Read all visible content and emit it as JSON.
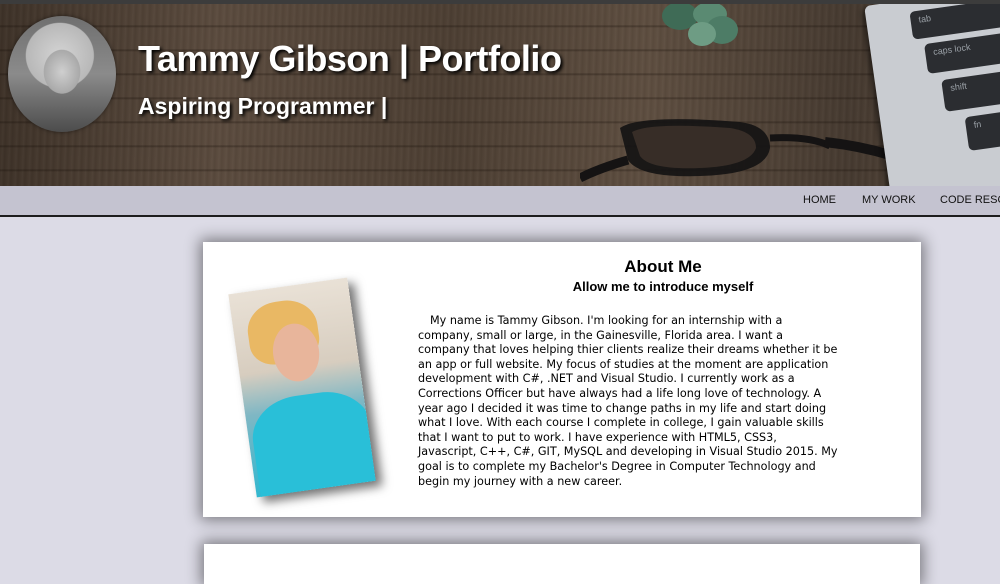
{
  "header": {
    "title": "Tammy Gibson | Portfolio",
    "subtitle": "Aspiring Programmer |"
  },
  "banner_keys": [
    "tab",
    "caps lock",
    "shift",
    "fn"
  ],
  "nav": {
    "items": [
      "HOME",
      "MY WORK",
      "CODE RESOU"
    ]
  },
  "about": {
    "title": "About Me",
    "subtitle": "Allow me to introduce myself",
    "body": "My name is Tammy Gibson. I'm looking for an internship with a company, small or large, in the Gainesville, Florida area. I want a company that loves helping thier clients realize their dreams whether it be an app or full website. My focus of studies at the moment are application development with C#, .NET and Visual Studio. I currently work as a Corrections Officer but have always had a life long love of technology. A year ago I decided it was time to change paths in my life and start doing what I love. With each course I complete in college, I gain valuable skills that I want to put to work. I have experience with HTML5, CSS3, Javascript, C++, C#, GIT, MySQL and developing in Visual Studio 2015. My goal is to complete my Bachelor's Degree in Computer Technology and begin my journey with a new career."
  },
  "colors": {
    "page_bg": "#dcdbe6",
    "nav_bg": "#c4c3d0",
    "card_bg": "#ffffff"
  }
}
